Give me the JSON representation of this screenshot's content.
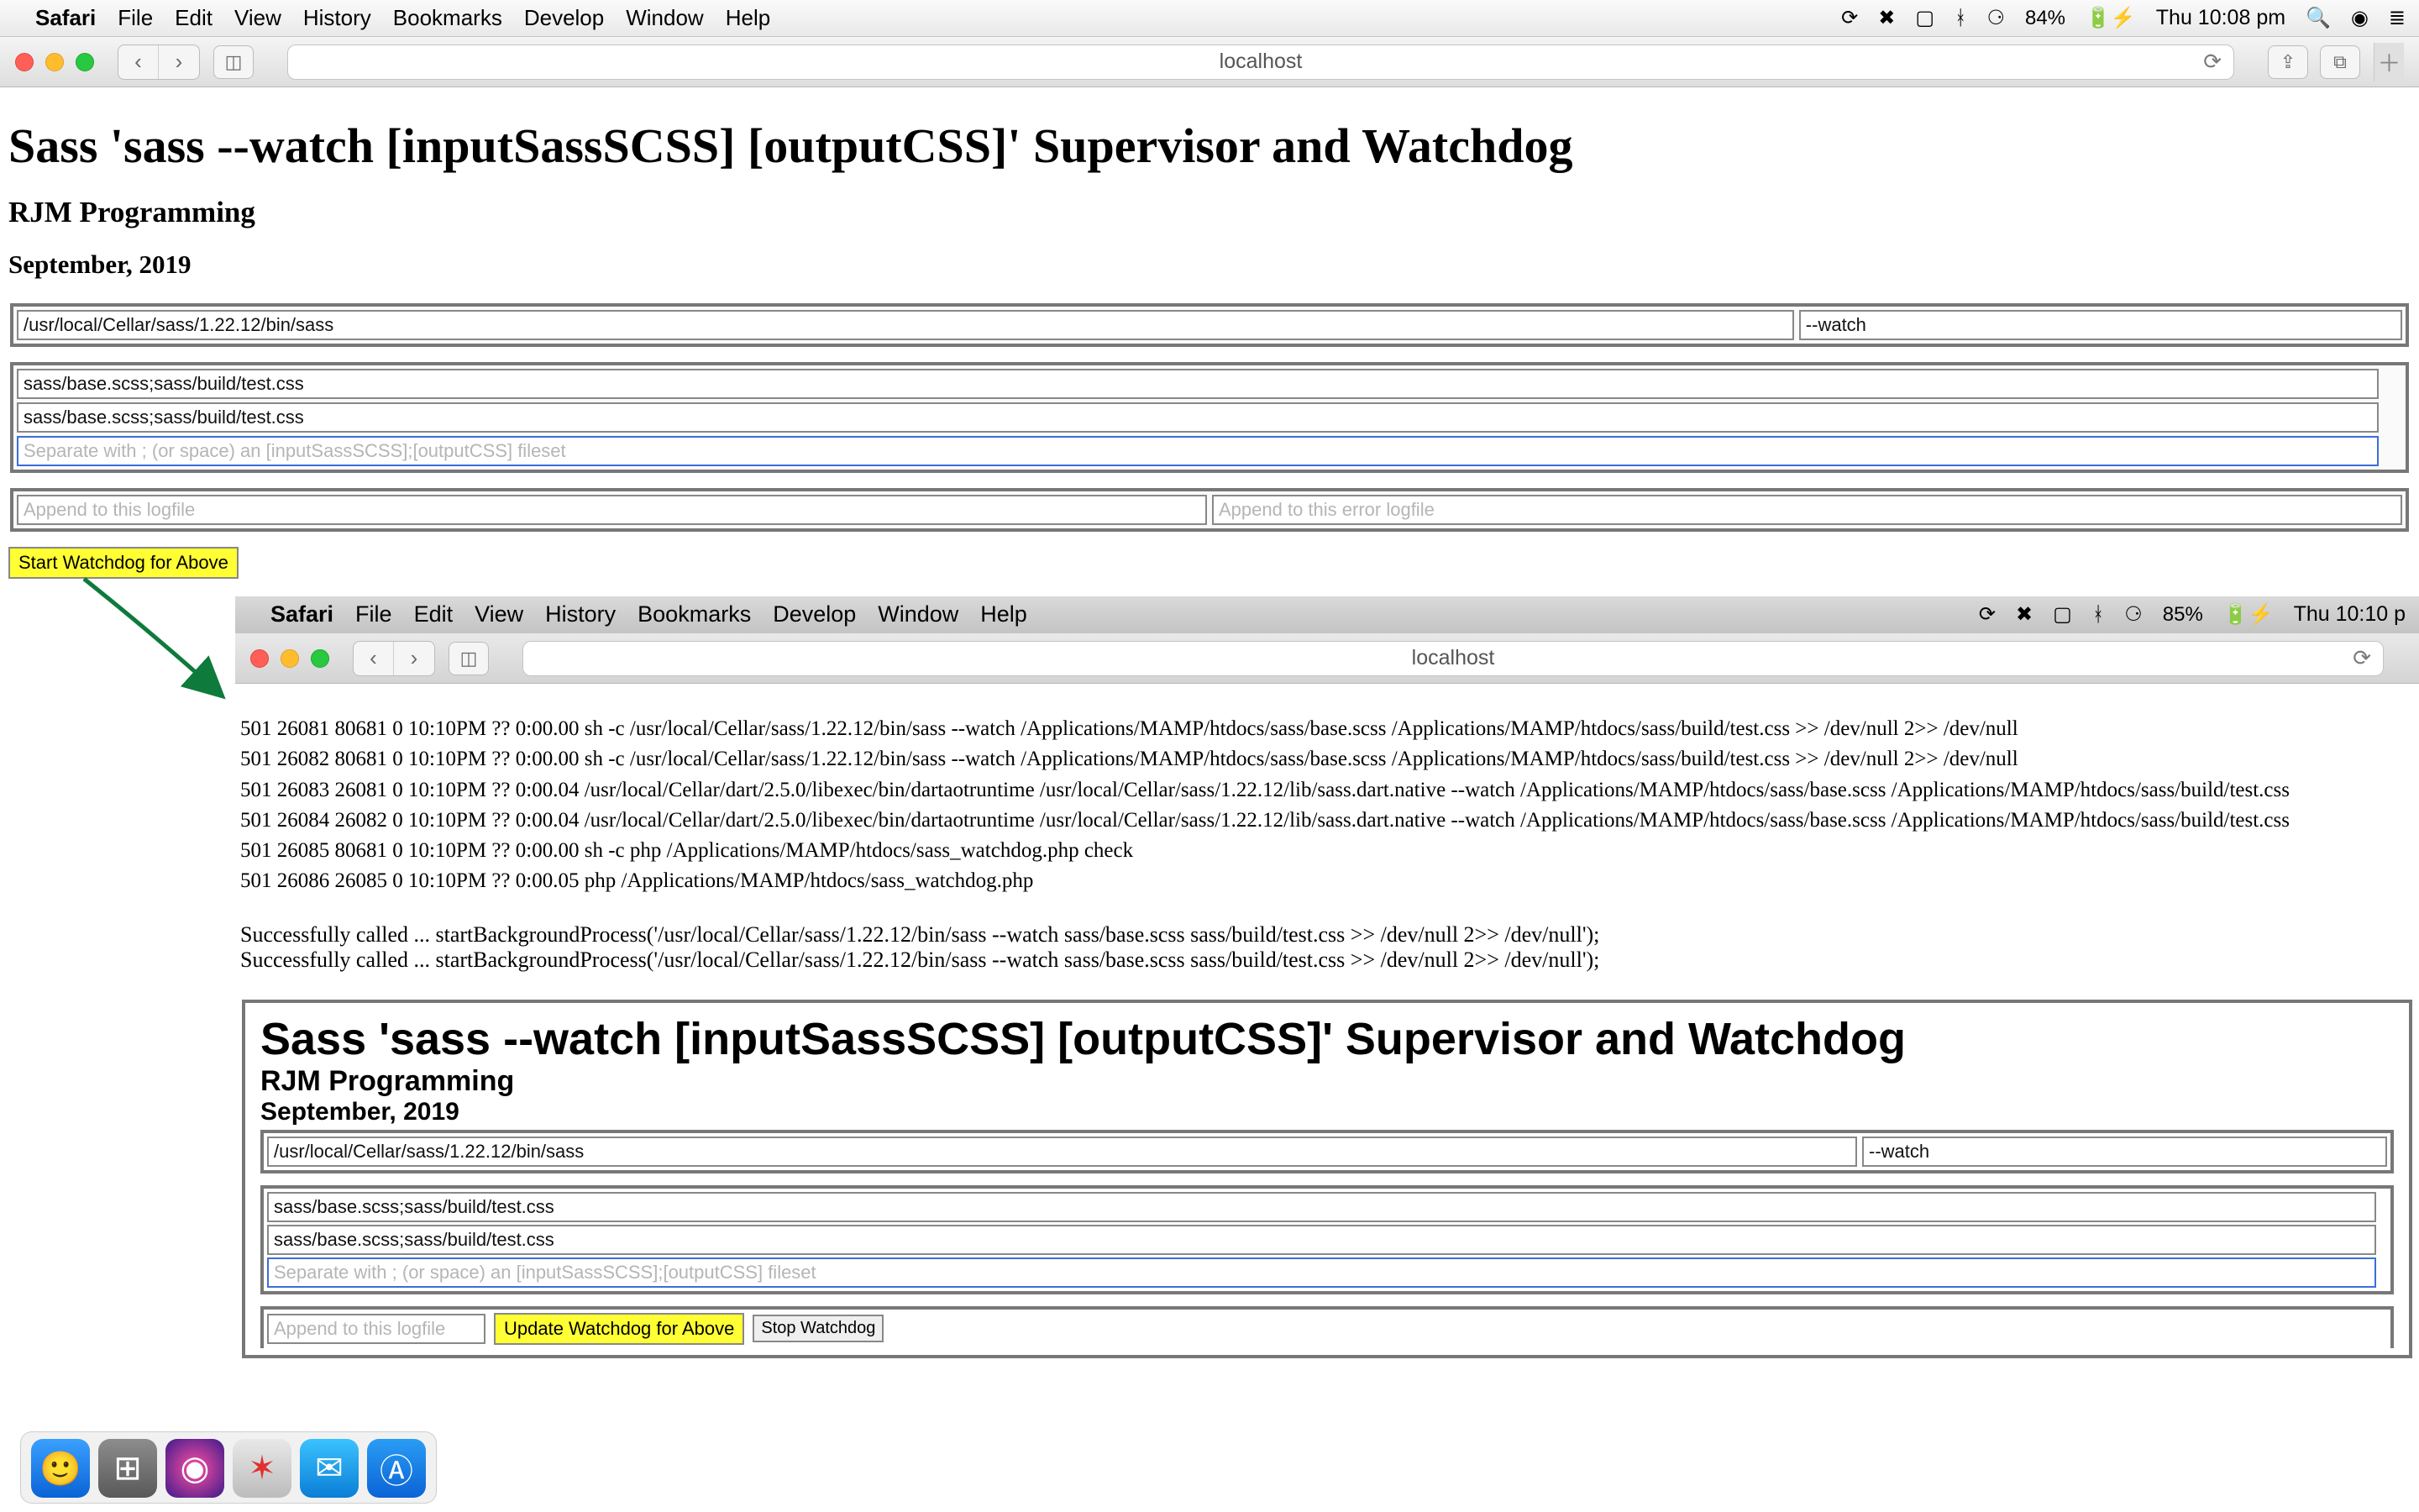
{
  "menubar1": {
    "app": "Safari",
    "items": [
      "File",
      "Edit",
      "View",
      "History",
      "Bookmarks",
      "Develop",
      "Window",
      "Help"
    ],
    "battery": "84%",
    "clock": "Thu 10:08 pm"
  },
  "toolbar1": {
    "url": "localhost"
  },
  "page1": {
    "h1": "Sass 'sass --watch [inputSassSCSS] [outputCSS]' Supervisor and Watchdog",
    "h2": "RJM Programming",
    "h3": "September, 2019",
    "sassPath": "/usr/local/Cellar/sass/1.22.12/bin/sass",
    "watchFlag": "--watch",
    "fileset1": "sass/base.scss;sass/build/test.css",
    "fileset2": "sass/base.scss;sass/build/test.css",
    "filesetPlaceholder": "Separate with ; (or space) an [inputSassSCSS];[outputCSS] fileset",
    "logPlaceholder": "Append to this logfile",
    "errlogPlaceholder": "Append to this error logfile",
    "startBtn": "Start Watchdog for Above"
  },
  "menubar2": {
    "app": "Safari",
    "items": [
      "File",
      "Edit",
      "View",
      "History",
      "Bookmarks",
      "Develop",
      "Window",
      "Help"
    ],
    "battery": "85%",
    "clock": "Thu 10:10 p"
  },
  "toolbar2": {
    "url": "localhost"
  },
  "logs": [
    "501 26081 80681 0 10:10PM ?? 0:00.00 sh -c /usr/local/Cellar/sass/1.22.12/bin/sass --watch /Applications/MAMP/htdocs/sass/base.scss /Applications/MAMP/htdocs/sass/build/test.css >> /dev/null 2>> /dev/null",
    "501 26082 80681 0 10:10PM ?? 0:00.00 sh -c /usr/local/Cellar/sass/1.22.12/bin/sass --watch /Applications/MAMP/htdocs/sass/base.scss /Applications/MAMP/htdocs/sass/build/test.css >> /dev/null 2>> /dev/null",
    "501 26083 26081 0 10:10PM ?? 0:00.04 /usr/local/Cellar/dart/2.5.0/libexec/bin/dartaotruntime /usr/local/Cellar/sass/1.22.12/lib/sass.dart.native --watch /Applications/MAMP/htdocs/sass/base.scss /Applications/MAMP/htdocs/sass/build/test.css",
    "501 26084 26082 0 10:10PM ?? 0:00.04 /usr/local/Cellar/dart/2.5.0/libexec/bin/dartaotruntime /usr/local/Cellar/sass/1.22.12/lib/sass.dart.native --watch /Applications/MAMP/htdocs/sass/base.scss /Applications/MAMP/htdocs/sass/build/test.css",
    "501 26085 80681 0 10:10PM ?? 0:00.00 sh -c php /Applications/MAMP/htdocs/sass_watchdog.php check",
    "501 26086 26085 0 10:10PM ?? 0:00.05 php /Applications/MAMP/htdocs/sass_watchdog.php"
  ],
  "success": [
    "Successfully called ... startBackgroundProcess('/usr/local/Cellar/sass/1.22.12/bin/sass --watch sass/base.scss sass/build/test.css >> /dev/null 2>> /dev/null');",
    "Successfully called ... startBackgroundProcess('/usr/local/Cellar/sass/1.22.12/bin/sass --watch sass/base.scss sass/build/test.css >> /dev/null 2>> /dev/null');"
  ],
  "page2": {
    "h1": "Sass 'sass --watch [inputSassSCSS] [outputCSS]' Supervisor and Watchdog",
    "h2": "RJM Programming",
    "h3": "September, 2019",
    "sassPath": "/usr/local/Cellar/sass/1.22.12/bin/sass",
    "watchFlag": "--watch",
    "fileset1": "sass/base.scss;sass/build/test.css",
    "fileset2": "sass/base.scss;sass/build/test.css",
    "filesetPlaceholder": "Separate with ; (or space) an [inputSassSCSS];[outputCSS] fileset",
    "logPlaceholder": "Append to this logfile",
    "updateBtn": "Update Watchdog for Above",
    "stopBtn": "Stop Watchdog"
  }
}
